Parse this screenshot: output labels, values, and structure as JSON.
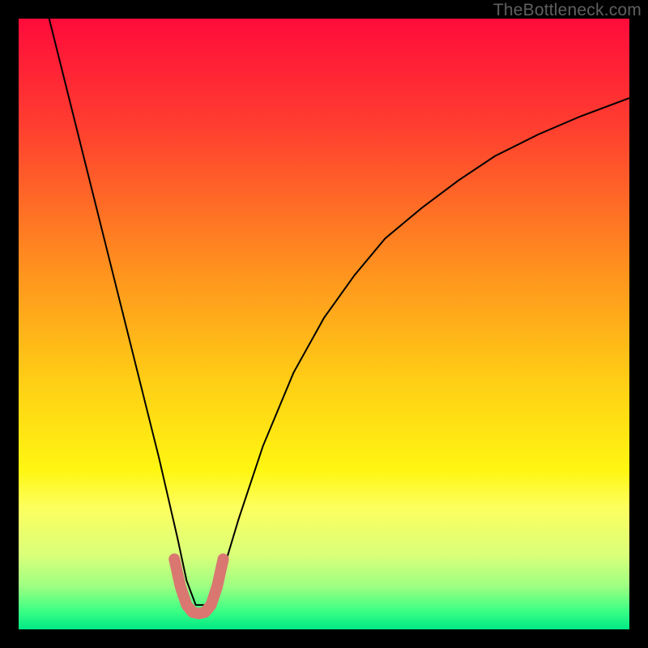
{
  "watermark": "TheBottleneck.com",
  "chart_data": {
    "type": "line",
    "title": "",
    "xlabel": "",
    "ylabel": "",
    "xlim": [
      0,
      100
    ],
    "ylim": [
      0,
      100
    ],
    "grid": false,
    "legend": false,
    "background_gradient": {
      "stops": [
        {
          "offset": 0.0,
          "color": "#ff0b3b"
        },
        {
          "offset": 0.18,
          "color": "#ff3f2f"
        },
        {
          "offset": 0.4,
          "color": "#ff8e1f"
        },
        {
          "offset": 0.6,
          "color": "#ffd015"
        },
        {
          "offset": 0.74,
          "color": "#fff612"
        },
        {
          "offset": 0.8,
          "color": "#fdff5e"
        },
        {
          "offset": 0.88,
          "color": "#d9ff7a"
        },
        {
          "offset": 0.93,
          "color": "#9cff82"
        },
        {
          "offset": 0.97,
          "color": "#3bff84"
        },
        {
          "offset": 1.0,
          "color": "#00e986"
        }
      ]
    },
    "series": [
      {
        "name": "bottleneck-curve",
        "stroke": "#000000",
        "stroke_width": 2,
        "x": [
          5,
          8,
          11,
          14,
          17,
          20,
          23,
          26,
          27.5,
          29,
          31,
          33,
          36,
          40,
          45,
          50,
          55,
          60,
          66,
          72,
          78,
          85,
          92,
          100
        ],
        "y": [
          100,
          88,
          76,
          64,
          52,
          40,
          28,
          15,
          8,
          4,
          4,
          8,
          18,
          30,
          42,
          51,
          58,
          64,
          69,
          73.5,
          77.5,
          81,
          84,
          87
        ]
      },
      {
        "name": "highlight-u",
        "stroke": "#d97770",
        "stroke_width": 14,
        "linecap": "round",
        "x": [
          25.5,
          26.5,
          27.5,
          28.5,
          29.5,
          30.5,
          31.5,
          32.5,
          33.5
        ],
        "y": [
          11.5,
          7.0,
          4.0,
          2.8,
          2.6,
          2.8,
          4.0,
          7.0,
          11.5
        ]
      }
    ]
  }
}
